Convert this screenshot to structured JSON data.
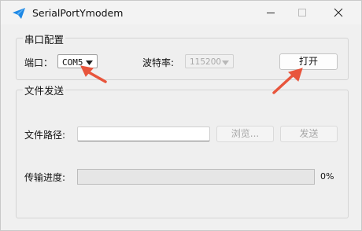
{
  "window": {
    "title": "SerialPortYmodem",
    "controls": {
      "minimize": "minimize",
      "maximize": "maximize",
      "close": "close"
    }
  },
  "serial_group": {
    "title": "串口配置",
    "port_label": "端口：",
    "port_value": "COM5",
    "baud_label": "波特率:",
    "baud_value": "115200",
    "open_button": "打开"
  },
  "file_group": {
    "title": "文件发送",
    "path_label": "文件路径:",
    "path_value": "",
    "browse_button": "浏览...",
    "send_button": "发送",
    "progress_label": "传输进度:",
    "progress_value": 0,
    "progress_text": "0%"
  },
  "colors": {
    "annotation_arrow": "#e8553c",
    "title_icon": "#1e88e5",
    "progress_fill": "#06b025"
  },
  "icons": {
    "app": "paper-plane-icon",
    "annotation": "red-arrow-icon"
  }
}
